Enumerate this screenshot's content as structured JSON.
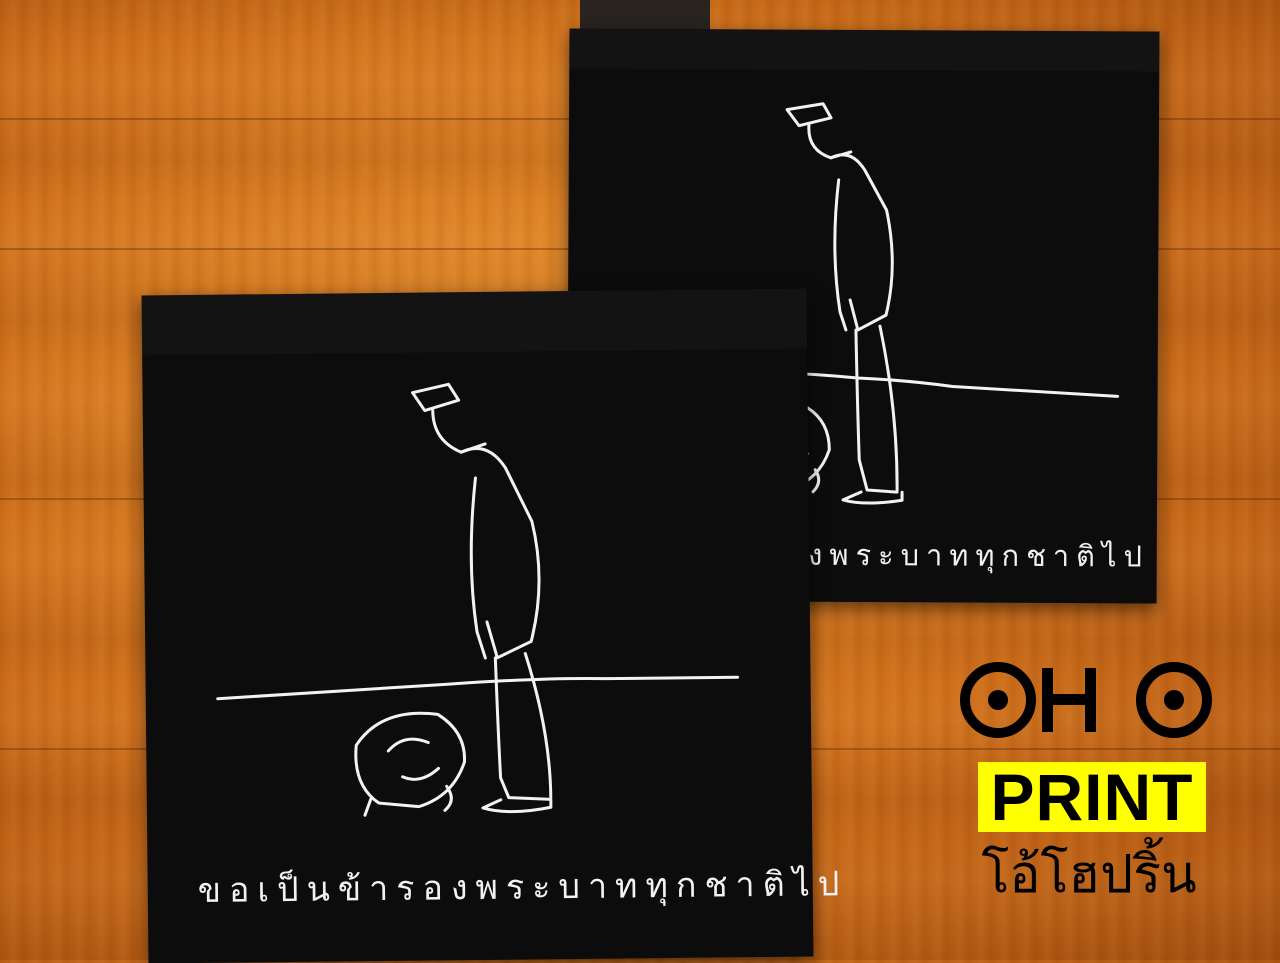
{
  "image": {
    "description_elements": {
      "shirts": [
        {
          "id": "left",
          "caption": "ขอเป็นข้ารองพระบาททุกชาติไป"
        },
        {
          "id": "right",
          "caption": "ขอเป็นข้ารองพระบาททุกชาติไป"
        }
      ]
    },
    "brand": {
      "logo_text_top": "OHO",
      "logo_text_print": "PRINT",
      "logo_text_thai": "โอ้โฮปริ้น",
      "accent_color": "#ffff00",
      "ink_color": "#000000"
    },
    "colors": {
      "wood": "#cf6f1b",
      "fabric": "#0c0c0c",
      "print_ink": "#f2f2f2"
    }
  }
}
